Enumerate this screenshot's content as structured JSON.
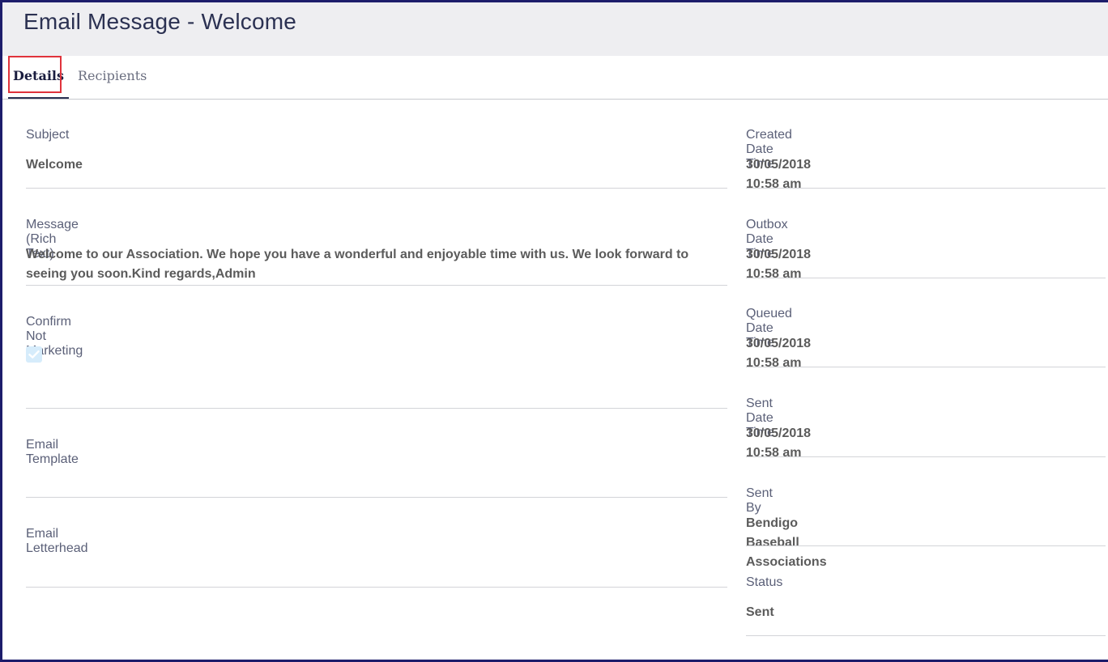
{
  "header": {
    "title": "Email Message - Welcome"
  },
  "tabs": [
    {
      "label": "Details",
      "active": true
    },
    {
      "label": "Recipients",
      "active": false
    }
  ],
  "left_fields": {
    "subject": {
      "label": "Subject",
      "value": "Welcome"
    },
    "message": {
      "label": "Message (Rich Text)",
      "value": "Welcome to our Association. We hope you have a wonderful and enjoyable time with us. We look forward to seeing you soon.Kind regards,Admin"
    },
    "confirm_not_marketing": {
      "label": "Confirm Not Marketing",
      "checked": true
    },
    "email_template": {
      "label": "Email Template",
      "value": ""
    },
    "email_letterhead": {
      "label": "Email Letterhead",
      "value": ""
    }
  },
  "right_fields": {
    "created": {
      "label": "Created Date Time",
      "value": "30/05/2018 10:58 am"
    },
    "outbox": {
      "label": "Outbox Date Time",
      "value": "30/05/2018 10:58 am"
    },
    "queued": {
      "label": "Queued Date Time",
      "value": "30/05/2018 10:58 am"
    },
    "sent": {
      "label": "Sent Date Time",
      "value": "30/05/2018 10:58 am"
    },
    "sent_by": {
      "label": "Sent By",
      "value": "Bendigo Baseball Associations"
    },
    "status": {
      "label": "Status",
      "value": "Sent"
    }
  },
  "colors": {
    "accent": "#2b3152",
    "highlight": "#e0333c",
    "checkbox": "#d6ecfb"
  },
  "icons": {
    "checkbox": "check-icon"
  }
}
